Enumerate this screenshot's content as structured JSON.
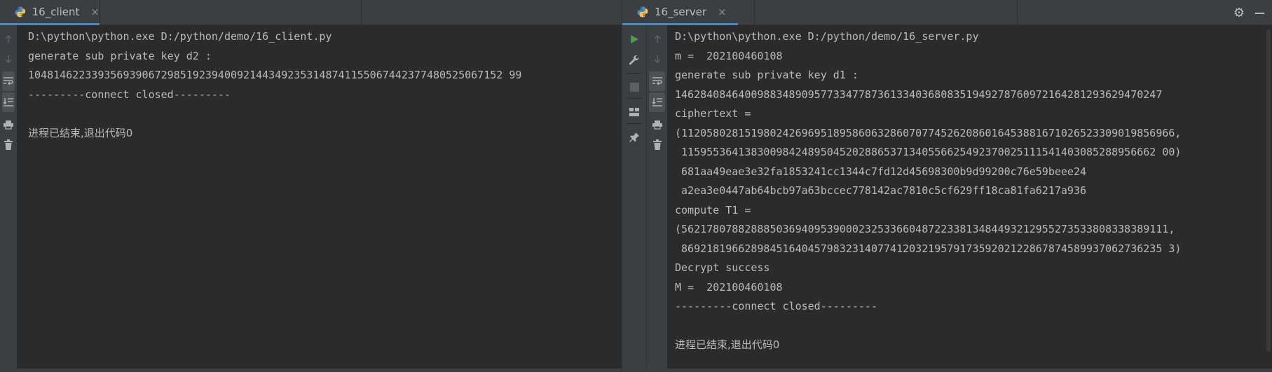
{
  "client": {
    "tab_label": "16_client",
    "close_glyph": "×",
    "lines": [
      "D:\\python\\python.exe D:/python/demo/16_client.py",
      "generate sub private key d2 :",
      "104814622339356939067298519239400921443492353148741155067442377480525067152 99",
      "---------connect closed---------",
      "",
      "进程已结束,退出代码0"
    ]
  },
  "server": {
    "tab_label": "16_server",
    "close_glyph": "×",
    "lines": [
      "D:\\python\\python.exe D:/python/demo/16_server.py",
      "m =  202100460108",
      "generate sub private key d1 :",
      "14628408464009883489095773347787361334036808351949278760972164281293629470247",
      "ciphertext =",
      "(112058028151980242696951895860632860707745262086016453881671026523309019856966,",
      " 115955364138300984248950452028865371340556625492370025111541403085288956662 00)",
      " 681aa49eae3e32fa1853241cc1344c7fd12d45698300b9d99200c76e59beee24",
      " a2ea3e0447ab64bcb97a63bccec778142ac7810c5cf629ff18ca81fa6217a936",
      "compute T1 =",
      "(56217807882888503694095390002325336604872233813484493212955273533808338389111,",
      " 8692181966289845164045798323140774120321957917359202122867874589937062736235 3)",
      "Decrypt success",
      "M =  202100460108",
      "---------connect closed---------",
      "",
      "进程已结束,退出代码0"
    ]
  },
  "icons": {
    "python": "python-file-icon",
    "settings": "gear-icon",
    "minimize": "minimize-icon"
  },
  "colors": {
    "background": "#2b2b2b",
    "panel": "#3c3f41",
    "text": "#bbbbbb",
    "run_green": "#499c54",
    "tab_underline": "#4a88c7"
  },
  "tabbar_right": {
    "settings_glyph": "⚙",
    "minimize_glyph": "—"
  }
}
